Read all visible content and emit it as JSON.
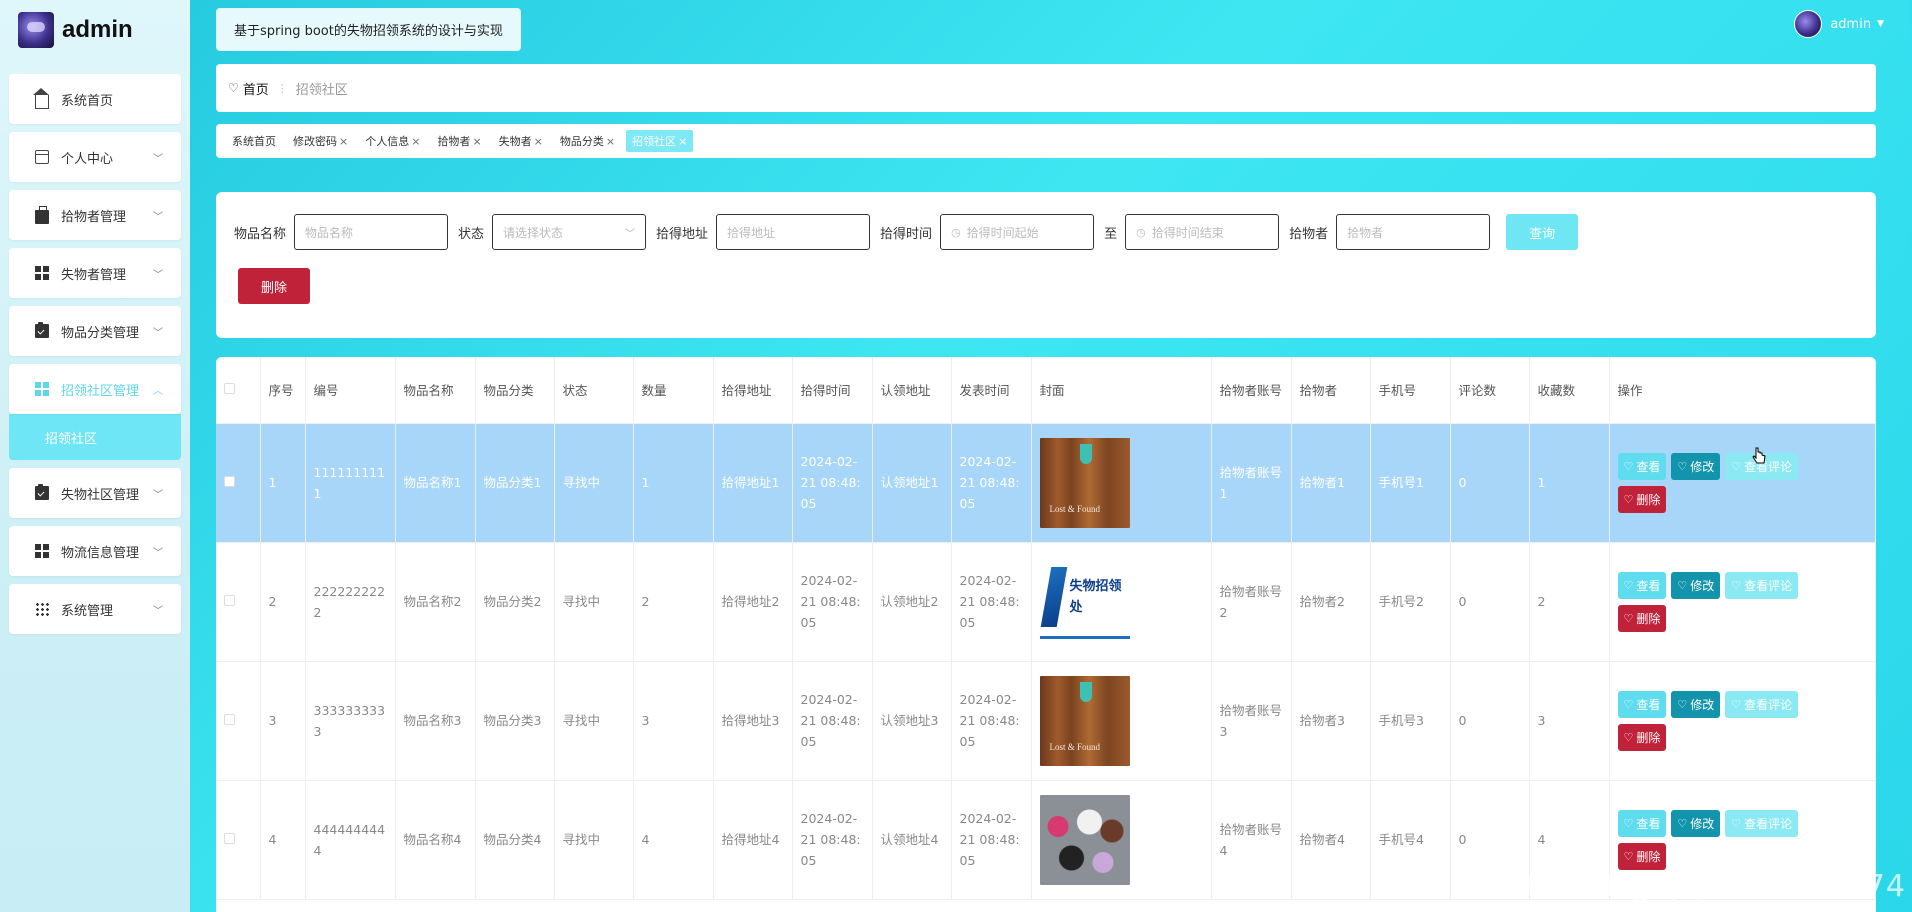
{
  "brand": {
    "title": "admin"
  },
  "sidebar": {
    "items": [
      {
        "label": "系统首页",
        "icon": "home-icon",
        "has_children": false
      },
      {
        "label": "个人中心",
        "icon": "card-icon",
        "has_children": true
      },
      {
        "label": "拾物者管理",
        "icon": "briefcase-icon",
        "has_children": true
      },
      {
        "label": "失物者管理",
        "icon": "grid-icon",
        "has_children": true
      },
      {
        "label": "物品分类管理",
        "icon": "clipboard-icon",
        "has_children": true
      },
      {
        "label": "招领社区管理",
        "icon": "grid-icon",
        "has_children": true,
        "expanded": true
      },
      {
        "label": "失物社区管理",
        "icon": "clipboard-icon",
        "has_children": true
      },
      {
        "label": "物流信息管理",
        "icon": "grid-icon",
        "has_children": true
      },
      {
        "label": "系统管理",
        "icon": "apps-icon",
        "has_children": true
      }
    ],
    "sub_active": "招领社区"
  },
  "header": {
    "system_title": "基于spring boot的失物招领系统的设计与实现",
    "user": "admin"
  },
  "breadcrumb": {
    "home": "首页",
    "current": "招领社区"
  },
  "tags": [
    {
      "label": "系统首页",
      "closable": false,
      "active": false
    },
    {
      "label": "修改密码",
      "closable": true,
      "active": false
    },
    {
      "label": "个人信息",
      "closable": true,
      "active": false
    },
    {
      "label": "拾物者",
      "closable": true,
      "active": false
    },
    {
      "label": "失物者",
      "closable": true,
      "active": false
    },
    {
      "label": "物品分类",
      "closable": true,
      "active": false
    },
    {
      "label": "招领社区",
      "closable": true,
      "active": true
    }
  ],
  "search": {
    "name_label": "物品名称",
    "name_placeholder": "物品名称",
    "status_label": "状态",
    "status_placeholder": "请选择状态",
    "address_label": "拾得地址",
    "address_placeholder": "拾得地址",
    "time_label": "拾得时间",
    "time_start_placeholder": "拾得时间起始",
    "time_to": "至",
    "time_end_placeholder": "拾得时间结束",
    "finder_label": "拾物者",
    "finder_placeholder": "拾物者",
    "query_button": "查询",
    "delete_button": "删除"
  },
  "table": {
    "columns": [
      "序号",
      "编号",
      "物品名称",
      "物品分类",
      "状态",
      "数量",
      "拾得地址",
      "拾得时间",
      "认领地址",
      "发表时间",
      "封面",
      "拾物者账号",
      "拾物者",
      "手机号",
      "评论数",
      "收藏数",
      "操作"
    ],
    "rows": [
      {
        "index": "1",
        "code": "1111111111",
        "name": "物品名称1",
        "category": "物品分类1",
        "status": "寻找中",
        "qty": "1",
        "pick_addr": "拾得地址1",
        "pick_time": "2024-02-21 08:48:05",
        "claim_addr": "认领地址1",
        "pub_time": "2024-02-21 08:48:05",
        "cover": "wood",
        "account": "拾物者账号1",
        "finder": "拾物者1",
        "phone": "手机号1",
        "comments": "0",
        "favorites": "1"
      },
      {
        "index": "2",
        "code": "2222222222",
        "name": "物品名称2",
        "category": "物品分类2",
        "status": "寻找中",
        "qty": "2",
        "pick_addr": "拾得地址2",
        "pick_time": "2024-02-21 08:48:05",
        "claim_addr": "认领地址2",
        "pub_time": "2024-02-21 08:48:05",
        "cover": "sign",
        "account": "拾物者账号2",
        "finder": "拾物者2",
        "phone": "手机号2",
        "comments": "0",
        "favorites": "2"
      },
      {
        "index": "3",
        "code": "3333333333",
        "name": "物品名称3",
        "category": "物品分类3",
        "status": "寻找中",
        "qty": "3",
        "pick_addr": "拾得地址3",
        "pick_time": "2024-02-21 08:48:05",
        "claim_addr": "认领地址3",
        "pub_time": "2024-02-21 08:48:05",
        "cover": "wood",
        "account": "拾物者账号3",
        "finder": "拾物者3",
        "phone": "手机号3",
        "comments": "0",
        "favorites": "3"
      },
      {
        "index": "4",
        "code": "4444444444",
        "name": "物品名称4",
        "category": "物品分类4",
        "status": "寻找中",
        "qty": "4",
        "pick_addr": "拾得地址4",
        "pick_time": "2024-02-21 08:48:05",
        "claim_addr": "认领地址4",
        "pub_time": "2024-02-21 08:48:05",
        "cover": "bags",
        "account": "拾物者账号4",
        "finder": "拾物者4",
        "phone": "手机号4",
        "comments": "0",
        "favorites": "4"
      }
    ],
    "actions": {
      "view": "查看",
      "edit": "修改",
      "comments": "查看评论",
      "delete": "删除"
    },
    "cover_text": {
      "sign": "失物招领处"
    }
  },
  "watermark": "CSDN @QQ3359892174",
  "colors": {
    "accent": "#5fd6e9",
    "danger": "#c0223a",
    "edit": "#1394ad",
    "row_highlight": "#a7d6f8"
  }
}
